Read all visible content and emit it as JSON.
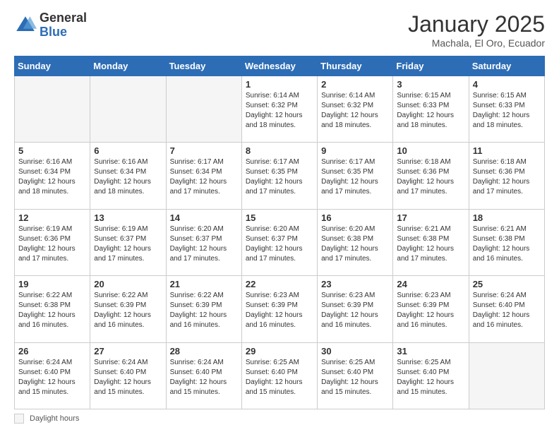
{
  "logo": {
    "general": "General",
    "blue": "Blue"
  },
  "header": {
    "month": "January 2025",
    "location": "Machala, El Oro, Ecuador"
  },
  "days_of_week": [
    "Sunday",
    "Monday",
    "Tuesday",
    "Wednesday",
    "Thursday",
    "Friday",
    "Saturday"
  ],
  "weeks": [
    [
      {
        "day": "",
        "empty": true
      },
      {
        "day": "",
        "empty": true
      },
      {
        "day": "",
        "empty": true
      },
      {
        "day": "1",
        "sunrise": "6:14 AM",
        "sunset": "6:32 PM",
        "daylight": "12 hours and 18 minutes."
      },
      {
        "day": "2",
        "sunrise": "6:14 AM",
        "sunset": "6:32 PM",
        "daylight": "12 hours and 18 minutes."
      },
      {
        "day": "3",
        "sunrise": "6:15 AM",
        "sunset": "6:33 PM",
        "daylight": "12 hours and 18 minutes."
      },
      {
        "day": "4",
        "sunrise": "6:15 AM",
        "sunset": "6:33 PM",
        "daylight": "12 hours and 18 minutes."
      }
    ],
    [
      {
        "day": "5",
        "sunrise": "6:16 AM",
        "sunset": "6:34 PM",
        "daylight": "12 hours and 18 minutes."
      },
      {
        "day": "6",
        "sunrise": "6:16 AM",
        "sunset": "6:34 PM",
        "daylight": "12 hours and 18 minutes."
      },
      {
        "day": "7",
        "sunrise": "6:17 AM",
        "sunset": "6:34 PM",
        "daylight": "12 hours and 17 minutes."
      },
      {
        "day": "8",
        "sunrise": "6:17 AM",
        "sunset": "6:35 PM",
        "daylight": "12 hours and 17 minutes."
      },
      {
        "day": "9",
        "sunrise": "6:17 AM",
        "sunset": "6:35 PM",
        "daylight": "12 hours and 17 minutes."
      },
      {
        "day": "10",
        "sunrise": "6:18 AM",
        "sunset": "6:36 PM",
        "daylight": "12 hours and 17 minutes."
      },
      {
        "day": "11",
        "sunrise": "6:18 AM",
        "sunset": "6:36 PM",
        "daylight": "12 hours and 17 minutes."
      }
    ],
    [
      {
        "day": "12",
        "sunrise": "6:19 AM",
        "sunset": "6:36 PM",
        "daylight": "12 hours and 17 minutes."
      },
      {
        "day": "13",
        "sunrise": "6:19 AM",
        "sunset": "6:37 PM",
        "daylight": "12 hours and 17 minutes."
      },
      {
        "day": "14",
        "sunrise": "6:20 AM",
        "sunset": "6:37 PM",
        "daylight": "12 hours and 17 minutes."
      },
      {
        "day": "15",
        "sunrise": "6:20 AM",
        "sunset": "6:37 PM",
        "daylight": "12 hours and 17 minutes."
      },
      {
        "day": "16",
        "sunrise": "6:20 AM",
        "sunset": "6:38 PM",
        "daylight": "12 hours and 17 minutes."
      },
      {
        "day": "17",
        "sunrise": "6:21 AM",
        "sunset": "6:38 PM",
        "daylight": "12 hours and 17 minutes."
      },
      {
        "day": "18",
        "sunrise": "6:21 AM",
        "sunset": "6:38 PM",
        "daylight": "12 hours and 16 minutes."
      }
    ],
    [
      {
        "day": "19",
        "sunrise": "6:22 AM",
        "sunset": "6:38 PM",
        "daylight": "12 hours and 16 minutes."
      },
      {
        "day": "20",
        "sunrise": "6:22 AM",
        "sunset": "6:39 PM",
        "daylight": "12 hours and 16 minutes."
      },
      {
        "day": "21",
        "sunrise": "6:22 AM",
        "sunset": "6:39 PM",
        "daylight": "12 hours and 16 minutes."
      },
      {
        "day": "22",
        "sunrise": "6:23 AM",
        "sunset": "6:39 PM",
        "daylight": "12 hours and 16 minutes."
      },
      {
        "day": "23",
        "sunrise": "6:23 AM",
        "sunset": "6:39 PM",
        "daylight": "12 hours and 16 minutes."
      },
      {
        "day": "24",
        "sunrise": "6:23 AM",
        "sunset": "6:39 PM",
        "daylight": "12 hours and 16 minutes."
      },
      {
        "day": "25",
        "sunrise": "6:24 AM",
        "sunset": "6:40 PM",
        "daylight": "12 hours and 16 minutes."
      }
    ],
    [
      {
        "day": "26",
        "sunrise": "6:24 AM",
        "sunset": "6:40 PM",
        "daylight": "12 hours and 15 minutes."
      },
      {
        "day": "27",
        "sunrise": "6:24 AM",
        "sunset": "6:40 PM",
        "daylight": "12 hours and 15 minutes."
      },
      {
        "day": "28",
        "sunrise": "6:24 AM",
        "sunset": "6:40 PM",
        "daylight": "12 hours and 15 minutes."
      },
      {
        "day": "29",
        "sunrise": "6:25 AM",
        "sunset": "6:40 PM",
        "daylight": "12 hours and 15 minutes."
      },
      {
        "day": "30",
        "sunrise": "6:25 AM",
        "sunset": "6:40 PM",
        "daylight": "12 hours and 15 minutes."
      },
      {
        "day": "31",
        "sunrise": "6:25 AM",
        "sunset": "6:40 PM",
        "daylight": "12 hours and 15 minutes."
      },
      {
        "day": "",
        "empty": true
      }
    ]
  ],
  "footer": {
    "daylight_label": "Daylight hours"
  }
}
